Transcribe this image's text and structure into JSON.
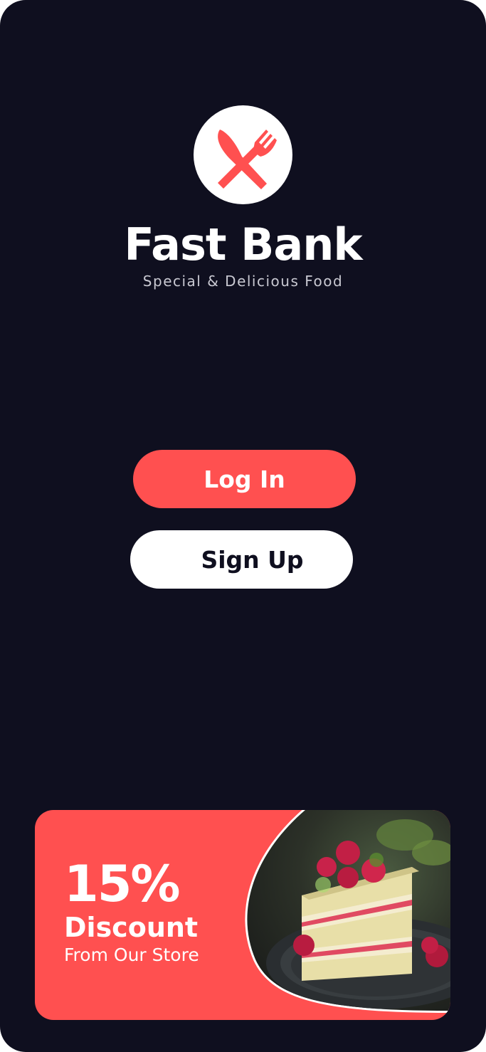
{
  "app": {
    "title": "Fast Bank",
    "tagline": "Special & Delicious Food",
    "logo_icon": "fork-knife-icon"
  },
  "actions": {
    "login_label": "Log In",
    "signup_label": "Sign Up"
  },
  "promo": {
    "percent": "15%",
    "headline": "Discount",
    "subtitle": "From Our Store",
    "image": "raspberry-cake-image"
  },
  "colors": {
    "background": "#0f0f1f",
    "accent": "#ff5050",
    "button_light": "#ffffff",
    "tagline": "#c9c9d2"
  }
}
